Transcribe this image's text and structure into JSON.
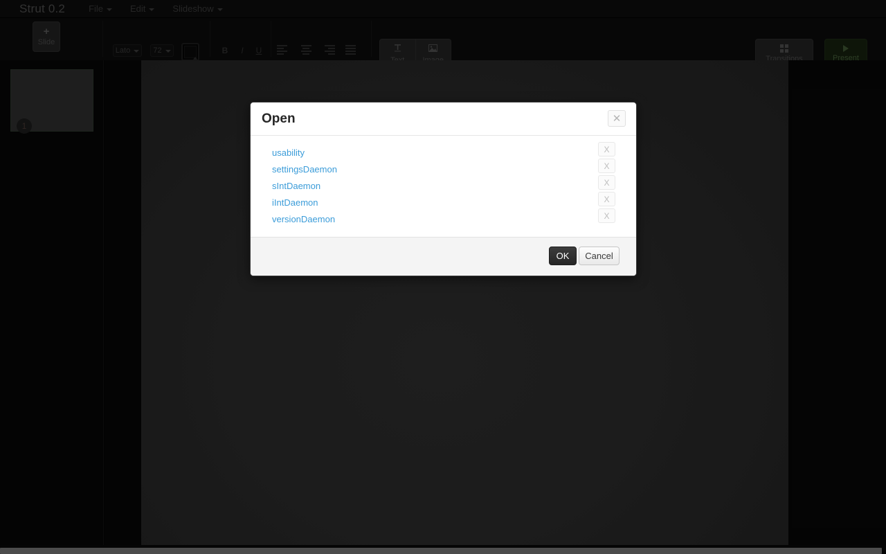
{
  "app": {
    "brand": "Strut 0.2",
    "menus": [
      {
        "label": "File"
      },
      {
        "label": "Edit"
      },
      {
        "label": "Slideshow"
      }
    ]
  },
  "toolbar": {
    "slide_button": {
      "label": "Slide",
      "glyph": "+"
    },
    "font_family": "Lato",
    "font_size": "72",
    "bold_label": "B",
    "italic_label": "I",
    "underline_label": "U",
    "align_left_name": "align-left",
    "align_center_name": "align-center",
    "align_right_name": "align-right",
    "align_justify_name": "align-justify",
    "insert_text": {
      "label": "Text",
      "icon": "T"
    },
    "insert_image": {
      "label": "Image",
      "icon": "⛰"
    },
    "transitions_label": "Transitions",
    "present_label": "Present",
    "present_bg_color": "#16210f",
    "present_text_color": "#46603a"
  },
  "sidebar": {
    "slides": [
      {
        "number": "1",
        "selected": true
      }
    ]
  },
  "canvas": {
    "background_color": "#2b2b2b"
  },
  "dialog": {
    "title": "Open",
    "close_glyph": "✕",
    "link_color": "#3b9cd9",
    "items": [
      {
        "name": "usability",
        "delete_label": "X"
      },
      {
        "name": "settingsDaemon",
        "delete_label": "X"
      },
      {
        "name": "sIntDaemon",
        "delete_label": "X"
      },
      {
        "name": "iIntDaemon",
        "delete_label": "X"
      },
      {
        "name": "versionDaemon",
        "delete_label": "X"
      }
    ],
    "ok_label": "OK",
    "cancel_label": "Cancel"
  }
}
